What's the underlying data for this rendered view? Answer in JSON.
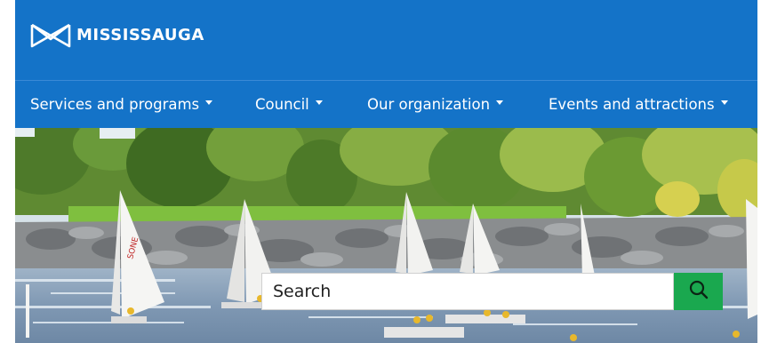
{
  "brand": {
    "name": "MISSISSAUGA",
    "logo_icon": "mississauga-logo-icon"
  },
  "nav": {
    "items": [
      {
        "label": "Services and programs"
      },
      {
        "label": "Council"
      },
      {
        "label": "Our organization"
      },
      {
        "label": "Events and attractions"
      }
    ]
  },
  "search": {
    "placeholder": "Search",
    "button_icon": "search-icon"
  },
  "colors": {
    "header": "#1473c8",
    "search_button": "#1aa84f"
  }
}
